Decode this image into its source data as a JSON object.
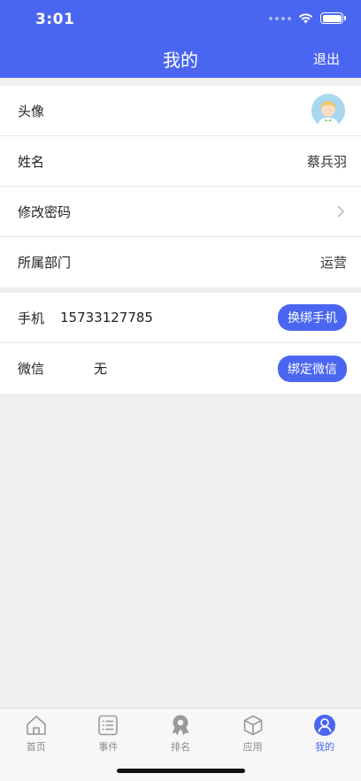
{
  "status_bar": {
    "time": "3:01"
  },
  "header": {
    "title": "我的",
    "logout_label": "退出"
  },
  "profile": {
    "avatar_label": "头像",
    "name_label": "姓名",
    "name_value": "蔡兵羽",
    "password_label": "修改密码",
    "department_label": "所属部门",
    "department_value": "运营"
  },
  "bindings": {
    "phone_label": "手机",
    "phone_value": "15733127785",
    "phone_button": "换绑手机",
    "wechat_label": "微信",
    "wechat_value": "无",
    "wechat_button": "绑定微信"
  },
  "tabbar": {
    "items": [
      {
        "label": "首页",
        "icon": "home-icon"
      },
      {
        "label": "事件",
        "icon": "list-icon"
      },
      {
        "label": "排名",
        "icon": "ranking-icon"
      },
      {
        "label": "应用",
        "icon": "cube-icon"
      },
      {
        "label": "我的",
        "icon": "user-icon"
      }
    ]
  },
  "colors": {
    "accent": "#4a66f0",
    "background": "#efefef"
  }
}
